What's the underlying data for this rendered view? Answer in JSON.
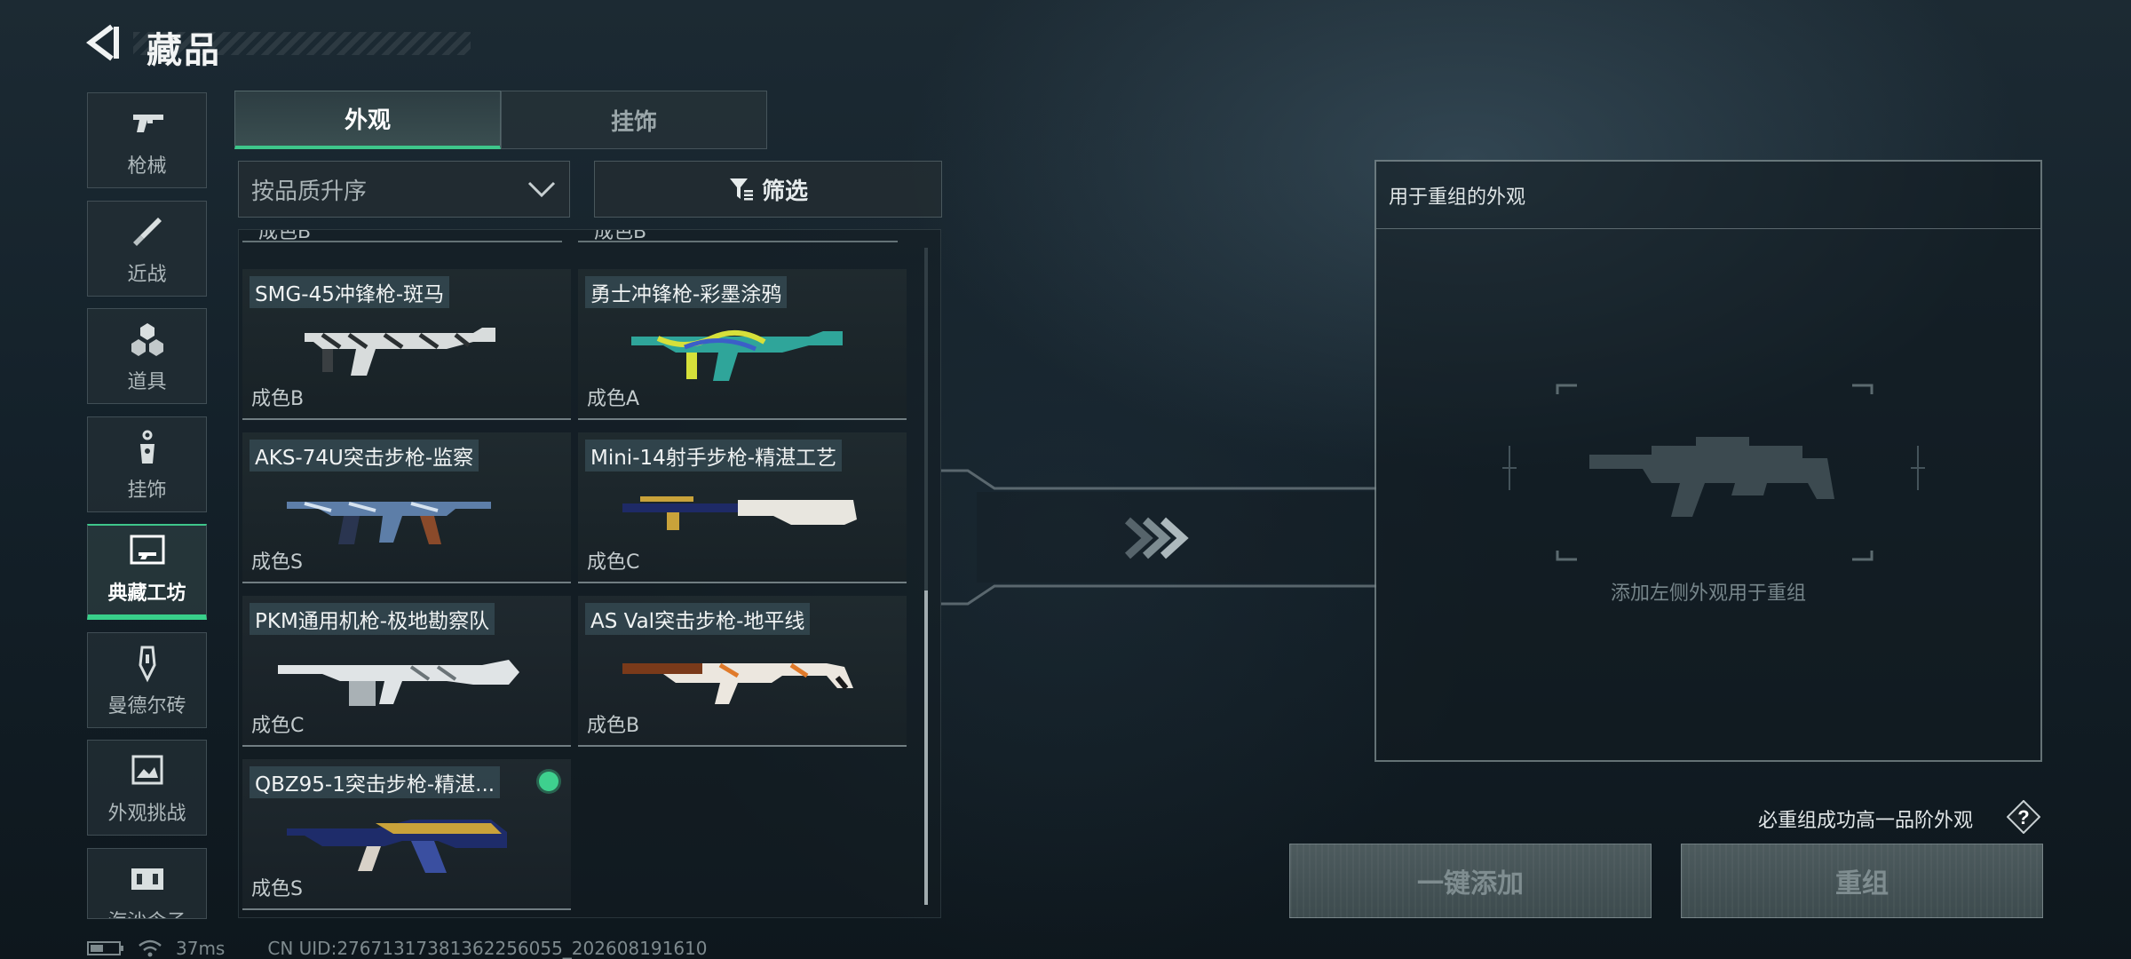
{
  "header": {
    "title": "藏品"
  },
  "sidebar": {
    "items": [
      {
        "label": "枪械",
        "icon": "pistol-icon"
      },
      {
        "label": "近战",
        "icon": "knife-icon"
      },
      {
        "label": "道具",
        "icon": "grenade-icon"
      },
      {
        "label": "挂饰",
        "icon": "charm-icon"
      },
      {
        "label": "典藏工坊",
        "icon": "workshop-frame-icon",
        "active": true
      },
      {
        "label": "曼德尔砖",
        "icon": "mandel-brick-icon"
      },
      {
        "label": "外观挑战",
        "icon": "challenge-image-icon"
      },
      {
        "label": "海沙令子",
        "icon": "gate-icon"
      }
    ]
  },
  "tabs": [
    {
      "label": "外观",
      "active": true
    },
    {
      "label": "挂饰",
      "active": false
    }
  ],
  "sort": {
    "selected": "按品质升序"
  },
  "filter": {
    "label": "筛选"
  },
  "grid": {
    "partial_row": [
      "成色B",
      "成色B"
    ],
    "items": [
      {
        "name": "SMG-45冲锋枪-斑马",
        "grade": "成色B",
        "selected": false
      },
      {
        "name": "勇士冲锋枪-彩墨涂鸦",
        "grade": "成色A",
        "selected": false
      },
      {
        "name": "AKS-74U突击步枪-监察",
        "grade": "成色S",
        "selected": false
      },
      {
        "name": "Mini-14射手步枪-精湛工艺",
        "grade": "成色C",
        "selected": false
      },
      {
        "name": "PKM通用机枪-极地勘察队",
        "grade": "成色C",
        "selected": false
      },
      {
        "name": "AS Val突击步枪-地平线",
        "grade": "成色B",
        "selected": false
      },
      {
        "name": "QBZ95-1突击步枪-精湛...",
        "grade": "成色S",
        "selected": true
      }
    ]
  },
  "recombine": {
    "title": "用于重组的外观",
    "hint": "添加左侧外观用于重组"
  },
  "guarantee_text": "必重组成功高一品阶外观",
  "help_label": "?",
  "buttons": {
    "add_all": "一键添加",
    "recombine": "重组"
  },
  "status": {
    "ping": "37ms",
    "uid": "CN UID:27671317381362256055_202608191610"
  },
  "colors": {
    "accent": "#3ec68b",
    "selected_dot": "#3ed08e",
    "panel_border": "#aab9bc"
  }
}
